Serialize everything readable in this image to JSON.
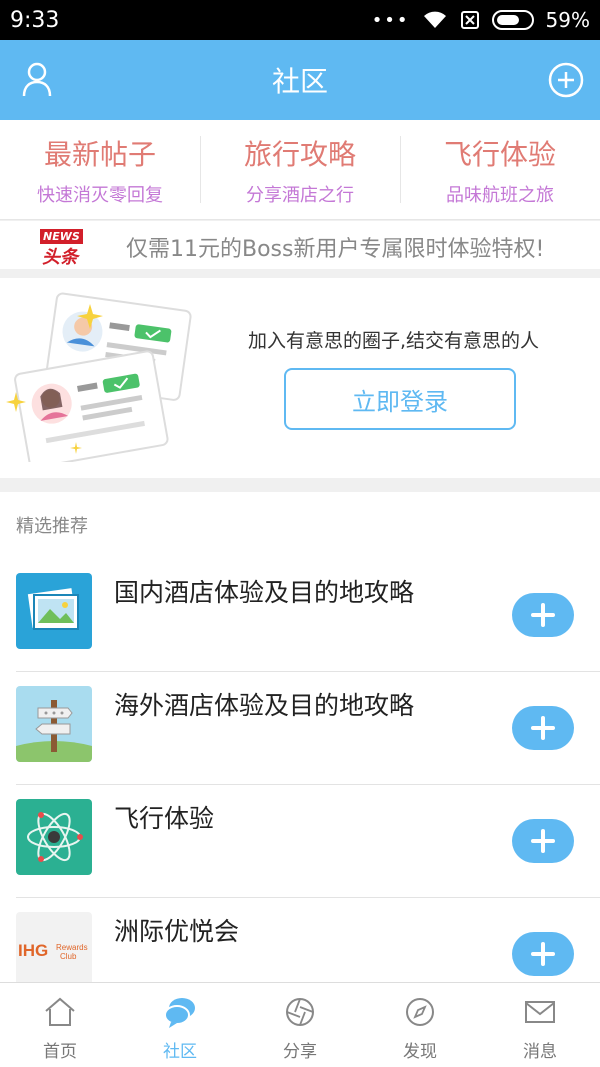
{
  "status_bar": {
    "time": "9:33",
    "dots": "•••",
    "battery_percent": "59%"
  },
  "header": {
    "title": "社区",
    "left_icon": "user-icon",
    "right_icon": "add-circle-icon"
  },
  "categories": [
    {
      "title": "最新帖子",
      "subtitle": "快速消灭零回复"
    },
    {
      "title": "旅行攻略",
      "subtitle": "分享酒店之行"
    },
    {
      "title": "飞行体验",
      "subtitle": "品味航班之旅"
    }
  ],
  "news": {
    "logo_top": "NEWS",
    "logo_bottom": "头条",
    "text": "仅需11元的Boss新用户专属限时体验特权!"
  },
  "login": {
    "slogan": "加入有意思的圈子,结交有意思的人",
    "button": "立即登录"
  },
  "recommend": {
    "header": "精选推荐",
    "items": [
      {
        "title": "国内酒店体验及目的地攻略",
        "icon": "photo-icon"
      },
      {
        "title": "海外酒店体验及目的地攻略",
        "icon": "signpost-icon"
      },
      {
        "title": "飞行体验",
        "icon": "atom-icon"
      },
      {
        "title": "洲际优悦会",
        "icon": "ihg-logo",
        "logo_text": "IHG",
        "logo_sub1": "Rewards",
        "logo_sub2": "Club"
      }
    ]
  },
  "tabs": [
    {
      "label": "首页",
      "icon": "home-icon",
      "active": false
    },
    {
      "label": "社区",
      "icon": "chat-icon",
      "active": true
    },
    {
      "label": "分享",
      "icon": "aperture-icon",
      "active": false
    },
    {
      "label": "发现",
      "icon": "compass-icon",
      "active": false
    },
    {
      "label": "消息",
      "icon": "mail-icon",
      "active": false
    }
  ],
  "colors": {
    "accent": "#5fb9f2",
    "category_title": "#e07b74",
    "category_sub": "#c478d6"
  }
}
